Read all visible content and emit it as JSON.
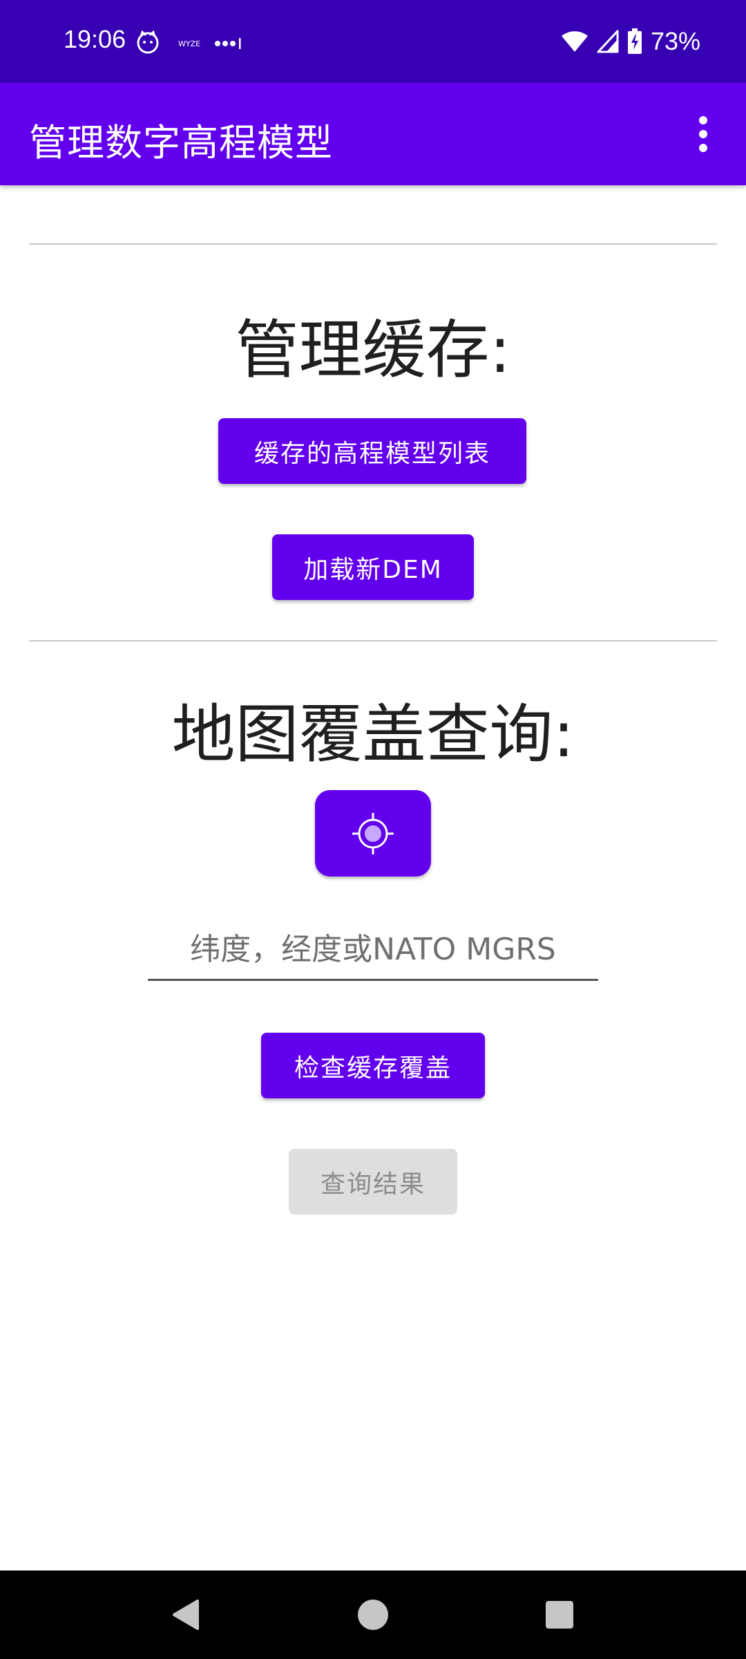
{
  "status_bar": {
    "time": "19:06",
    "battery_percent": "73%",
    "icons": [
      "cat-face-icon",
      "wyze-icon",
      "more-notifications-icon",
      "wifi-icon",
      "cell-signal-icon",
      "battery-charging-icon"
    ]
  },
  "app_bar": {
    "title": "管理数字高程模型",
    "overflow_icon": "more-vert-icon"
  },
  "cache_section": {
    "heading": "管理缓存:",
    "list_button": "缓存的高程模型列表",
    "load_button": "加载新DEM"
  },
  "coverage_section": {
    "heading": "地图覆盖查询:",
    "location_icon": "my-location-icon",
    "coord_input": {
      "value": "",
      "placeholder": "纬度，经度或NATO MGRS"
    },
    "check_button": "检查缓存覆盖",
    "result_button": "查询结果"
  },
  "nav_bar": {
    "icons": [
      "back-icon",
      "home-icon",
      "recents-icon"
    ]
  },
  "colors": {
    "status_bar": "#3700b3",
    "primary": "#6200ee",
    "disabled": "#dedede",
    "nav_bar": "#000000"
  }
}
